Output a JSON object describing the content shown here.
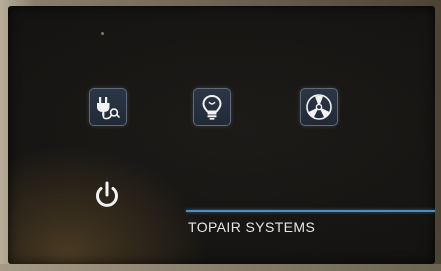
{
  "device": {
    "brand": "TOPAIR SYSTEMS"
  },
  "controls": [
    {
      "name": "plug-button",
      "icon": "power-plug-icon"
    },
    {
      "name": "light-button",
      "icon": "light-bulb-icon"
    },
    {
      "name": "fan-button",
      "icon": "fan-icon"
    },
    {
      "name": "power-button",
      "icon": "power-icon"
    }
  ],
  "colors": {
    "panel": "#151412",
    "button_fill": "#243040",
    "button_border": "#5e6a79",
    "accent_line": "#4f8fbf",
    "text": "#e6e6e6"
  }
}
